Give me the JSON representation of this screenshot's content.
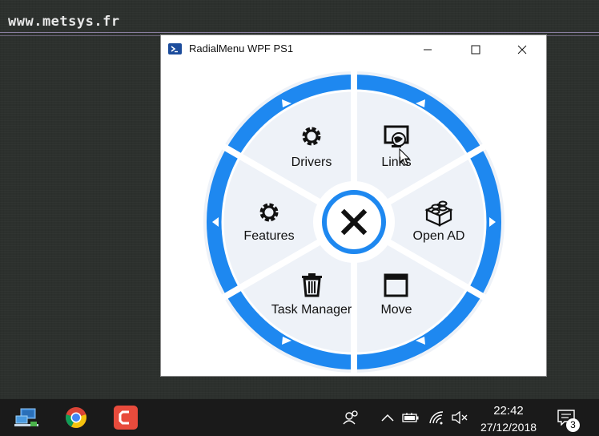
{
  "desktop": {
    "site_title": "www.metsys.fr"
  },
  "window": {
    "title": "RadialMenu WPF PS1",
    "controls": {
      "minimize_icon": "minimize-icon",
      "maximize_icon": "maximize-icon",
      "close_icon": "close-icon"
    }
  },
  "radial_menu": {
    "accent_color": "#1e88f0",
    "center_icon": "close-x-icon",
    "items": [
      {
        "label": "Drivers",
        "icon": "gear-icon"
      },
      {
        "label": "Links",
        "icon": "monitor-globe-icon"
      },
      {
        "label": "Open AD",
        "icon": "lego-brick-icon"
      },
      {
        "label": "Move",
        "icon": "window-icon"
      },
      {
        "label": "Task Manager",
        "icon": "trash-icon"
      },
      {
        "label": "Features",
        "icon": "gear-icon"
      }
    ]
  },
  "taskbar": {
    "apps": [
      {
        "icon": "network-computer-icon"
      },
      {
        "icon": "chrome-icon"
      },
      {
        "icon": "screenpresso-icon"
      }
    ],
    "tray": {
      "time": "22:42",
      "date": "27/12/2018",
      "notification_count": "3"
    }
  }
}
